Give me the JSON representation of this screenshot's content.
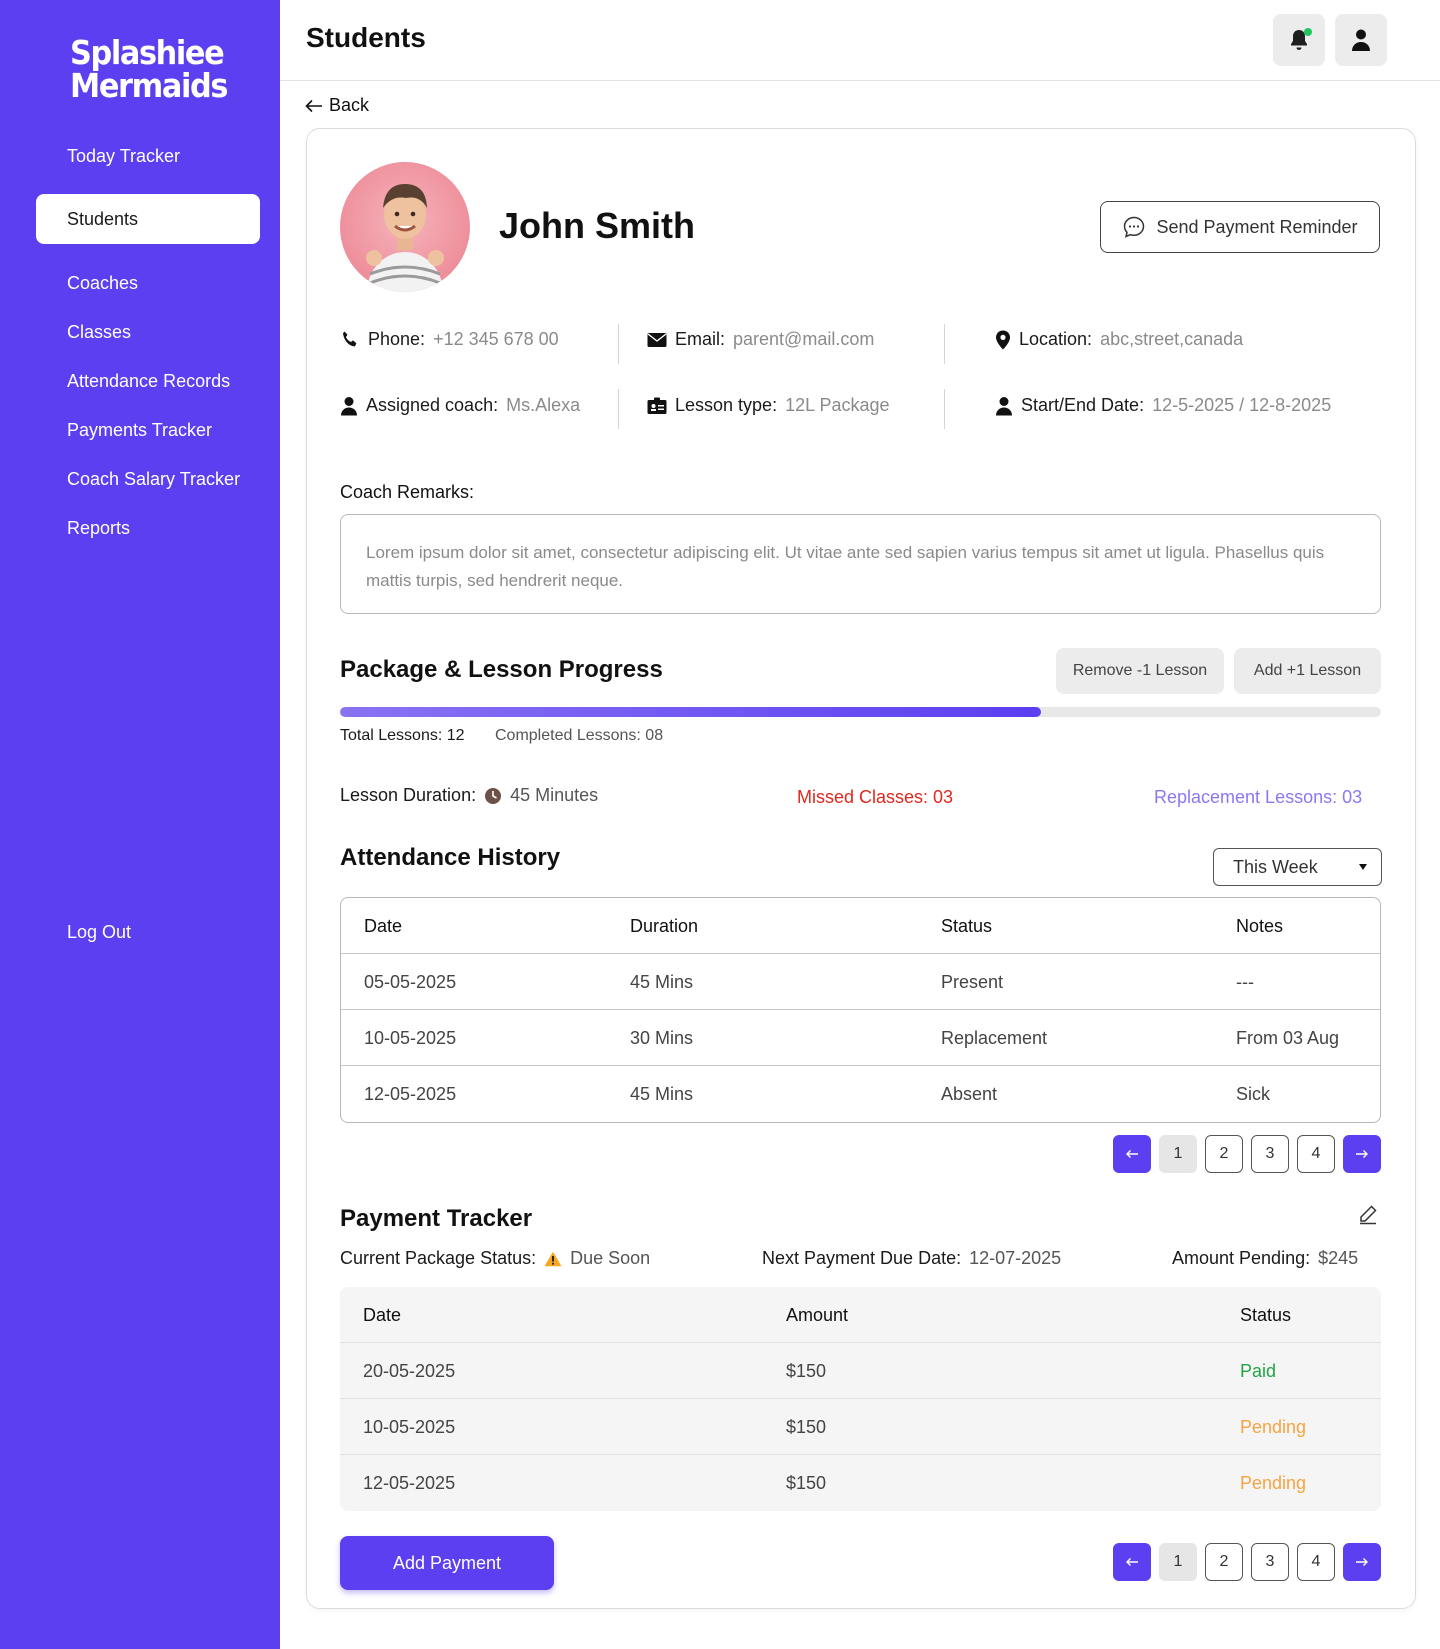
{
  "brand": {
    "line1": "Splashiee",
    "line2": "Mermaids"
  },
  "sidebar": {
    "items": [
      {
        "label": "Today Tracker"
      },
      {
        "label": "Students"
      },
      {
        "label": "Coaches"
      },
      {
        "label": "Classes"
      },
      {
        "label": "Attendance Records"
      },
      {
        "label": "Payments Tracker"
      },
      {
        "label": "Coach Salary Tracker"
      },
      {
        "label": "Reports"
      }
    ],
    "logout": "Log Out",
    "active_item": "Students"
  },
  "header": {
    "title": "Students"
  },
  "back_label": "Back",
  "student": {
    "name": "John Smith",
    "reminder_label": "Send Payment Reminder",
    "phone": {
      "label": "Phone:",
      "value": "+12 345 678 00"
    },
    "email": {
      "label": "Email:",
      "value": "parent@mail.com"
    },
    "location": {
      "label": "Location:",
      "value": "abc,street,canada"
    },
    "coach": {
      "label": "Assigned coach:",
      "value": "Ms.Alexa"
    },
    "lesson_type": {
      "label": "Lesson type:",
      "value": "12L Package"
    },
    "dates": {
      "label": "Start/End Date:",
      "value": "12-5-2025 / 12-8-2025"
    }
  },
  "remarks": {
    "label": "Coach Remarks:",
    "text": "Lorem ipsum dolor sit amet, consectetur adipiscing elit. Ut vitae ante sed sapien varius tempus sit amet ut ligula. Phasellus quis mattis turpis, sed hendrerit neque."
  },
  "progress": {
    "title": "Package & Lesson Progress",
    "remove_label": "Remove -1 Lesson",
    "add_label": "Add +1 Lesson",
    "completed_fraction": 0.673,
    "total_label": "Total Lessons: 12",
    "completed_label": "Completed Lessons: 08",
    "duration_label": "Lesson Duration:",
    "duration_value": "45 Minutes",
    "missed": "Missed Classes: 03",
    "replacement": "Replacement Lessons: 03"
  },
  "attendance": {
    "title": "Attendance History",
    "filter": "This Week",
    "columns": [
      "Date",
      "Duration",
      "Status",
      "Notes"
    ],
    "rows": [
      [
        "05-05-2025",
        "45 Mins",
        "Present",
        "---"
      ],
      [
        "10-05-2025",
        "30 Mins",
        "Replacement",
        "From 03 Aug"
      ],
      [
        "12-05-2025",
        "45 Mins",
        "Absent",
        "Sick"
      ]
    ],
    "pages": [
      "1",
      "2",
      "3",
      "4"
    ]
  },
  "payment": {
    "title": "Payment Tracker",
    "status_label": "Current Package Status:",
    "status_value": "Due Soon",
    "due_label": "Next Payment Due Date:",
    "due_value": "12-07-2025",
    "pending_label": "Amount Pending:",
    "pending_value": "$245",
    "columns": [
      "Date",
      "Amount",
      "Status"
    ],
    "rows": [
      [
        "20-05-2025",
        "$150",
        "Paid"
      ],
      [
        "10-05-2025",
        "$150",
        "Pending"
      ],
      [
        "12-05-2025",
        "$150",
        "Pending"
      ]
    ],
    "pages": [
      "1",
      "2",
      "3",
      "4"
    ],
    "add_label": "Add Payment"
  },
  "colors": {
    "brand": "#5b3ff0",
    "missed": "#e0281e",
    "replacement": "#8b78f2",
    "paid": "#22a447",
    "pending": "#f5a443"
  },
  "icons": {
    "notification": "bell-icon",
    "profile": "user-icon",
    "back": "arrow-left-icon",
    "reminder": "chat-bubble-icon",
    "phone": "phone-icon",
    "email": "envelope-icon",
    "location": "map-pin-icon",
    "coach": "user-icon",
    "lesson_type": "id-card-icon",
    "dates": "user-icon",
    "duration": "clock-icon",
    "warning": "warning-icon",
    "edit": "pencil-icon"
  }
}
